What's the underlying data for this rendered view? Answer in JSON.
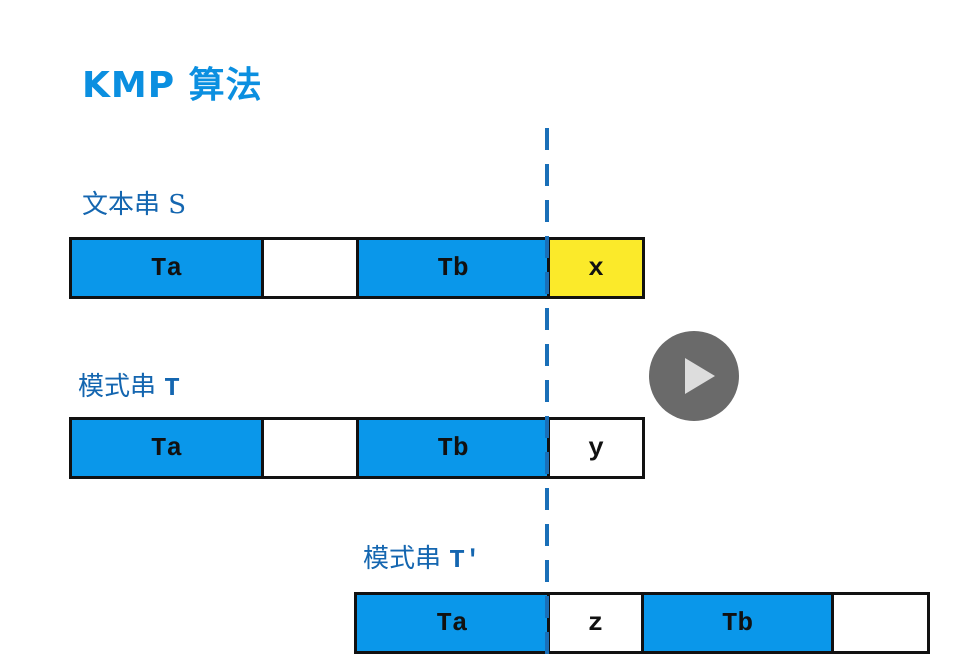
{
  "title": "KMP 算法",
  "rows": [
    {
      "label_cn": "文本串",
      "label_name": "S",
      "cells": [
        {
          "text": "Ta",
          "color": "blue"
        },
        {
          "text": "",
          "color": "white"
        },
        {
          "text": "Tb",
          "color": "blue"
        },
        {
          "text": "x",
          "color": "yellow"
        }
      ]
    },
    {
      "label_cn": "模式串",
      "label_name": "T",
      "cells": [
        {
          "text": "Ta",
          "color": "blue"
        },
        {
          "text": "",
          "color": "white"
        },
        {
          "text": "Tb",
          "color": "blue"
        },
        {
          "text": "y",
          "color": "white"
        }
      ]
    },
    {
      "label_cn": "模式串",
      "label_name": "T'",
      "cells": [
        {
          "text": "Ta",
          "color": "blue"
        },
        {
          "text": "z",
          "color": "white"
        },
        {
          "text": "Tb",
          "color": "blue"
        },
        {
          "text": "",
          "color": "white"
        }
      ]
    }
  ],
  "colors": {
    "blue": "#0a97ea",
    "yellow": "#fbea2a",
    "title": "#0b8fe0",
    "dash": "#1a6fb8"
  },
  "play_button": {
    "icon": "play-icon"
  }
}
